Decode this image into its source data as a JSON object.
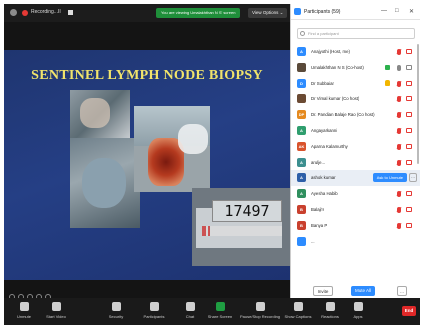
{
  "topbar": {
    "recording_label": "Recording...",
    "pause_label": "II",
    "viewing_notice": "You are viewing Umalakhthan N S' screen",
    "view_options_label": "View Options ⌄"
  },
  "slide": {
    "title": "SENTINEL LYMPH NODE BIOPSY",
    "counter_value": "17497"
  },
  "participants_panel": {
    "title": "Participants (59)",
    "window_controls": [
      "—",
      "□",
      "✕"
    ],
    "search_placeholder": "Find a participant",
    "ask_to_unmute_label": "Ask to Unmute",
    "more_label": "···",
    "invite_label": "Invite",
    "mute_all_label": "Mute All",
    "footer_more_label": "...",
    "items": [
      {
        "name": "Anajyothi (Host, me)",
        "initial": "A",
        "avatar_color": "#2d8cff",
        "icon": "",
        "mic": "muted",
        "cam": "off"
      },
      {
        "name": "Umalakhthan N S (Co-host)",
        "initial": "",
        "avatar_color": "#5a4a3a",
        "icon": "share",
        "mic": "on",
        "cam": "on"
      },
      {
        "name": "Dr Subbaiar",
        "initial": "D",
        "avatar_color": "#2d8cff",
        "icon": "hand",
        "mic": "muted",
        "cam": "off"
      },
      {
        "name": "Dr Vimal kumar (Co host)",
        "initial": "",
        "avatar_color": "#6b4a33",
        "icon": "",
        "mic": "muted",
        "cam": "off"
      },
      {
        "name": "Dr. Pandian Balaje Rao (Co host)",
        "initial": "DP",
        "avatar_color": "#e58a1f",
        "icon": "",
        "mic": "muted",
        "cam": "off"
      },
      {
        "name": "Angayarkanni",
        "initial": "A",
        "avatar_color": "#2f9e6e",
        "icon": "",
        "mic": "muted",
        "cam": "off"
      },
      {
        "name": "Aparna Kalamurthy",
        "initial": "AK",
        "avatar_color": "#d9532c",
        "icon": "",
        "mic": "muted",
        "cam": "off"
      },
      {
        "name": "arulje...",
        "initial": "A",
        "avatar_color": "#3c8f8f",
        "icon": "",
        "mic": "muted",
        "cam": "off"
      },
      {
        "name": "ashok kumar",
        "initial": "A",
        "avatar_color": "#2d5fa8",
        "icon": "",
        "mic": "ask",
        "cam": "off"
      },
      {
        "name": "Ayesha Habib",
        "initial": "A",
        "avatar_color": "#2f8f5e",
        "icon": "",
        "mic": "muted",
        "cam": "off"
      },
      {
        "name": "Balaji's",
        "initial": "B",
        "avatar_color": "#c9402e",
        "icon": "",
        "mic": "muted",
        "cam": "off"
      },
      {
        "name": "Banya P",
        "initial": "B",
        "avatar_color": "#c9402e",
        "icon": "",
        "mic": "muted",
        "cam": "off"
      },
      {
        "name": "...",
        "initial": "",
        "avatar_color": "#2d8cff",
        "icon": "",
        "mic": "",
        "cam": ""
      }
    ]
  },
  "toolbar": {
    "items": [
      {
        "label": "Unmute",
        "icon": "microphone-icon"
      },
      {
        "label": "Start Video",
        "icon": "video-camera-icon"
      },
      {
        "label": "Security",
        "icon": "shield-icon"
      },
      {
        "label": "Participants",
        "icon": "participants-icon",
        "badge": "59"
      },
      {
        "label": "Chat",
        "icon": "chat-icon"
      },
      {
        "label": "Share Screen",
        "icon": "share-screen-icon"
      },
      {
        "label": "Pause/Stop Recording",
        "icon": "record-icon"
      },
      {
        "label": "Show Captions",
        "icon": "captions-icon"
      },
      {
        "label": "Reactions",
        "icon": "reactions-icon"
      },
      {
        "label": "Apps",
        "icon": "apps-icon"
      }
    ],
    "end_label": "End"
  },
  "colors": {
    "accent_blue": "#2d8cff",
    "share_green": "#1f9e42",
    "end_red": "#e02828",
    "slide_title": "#f1e46b"
  }
}
